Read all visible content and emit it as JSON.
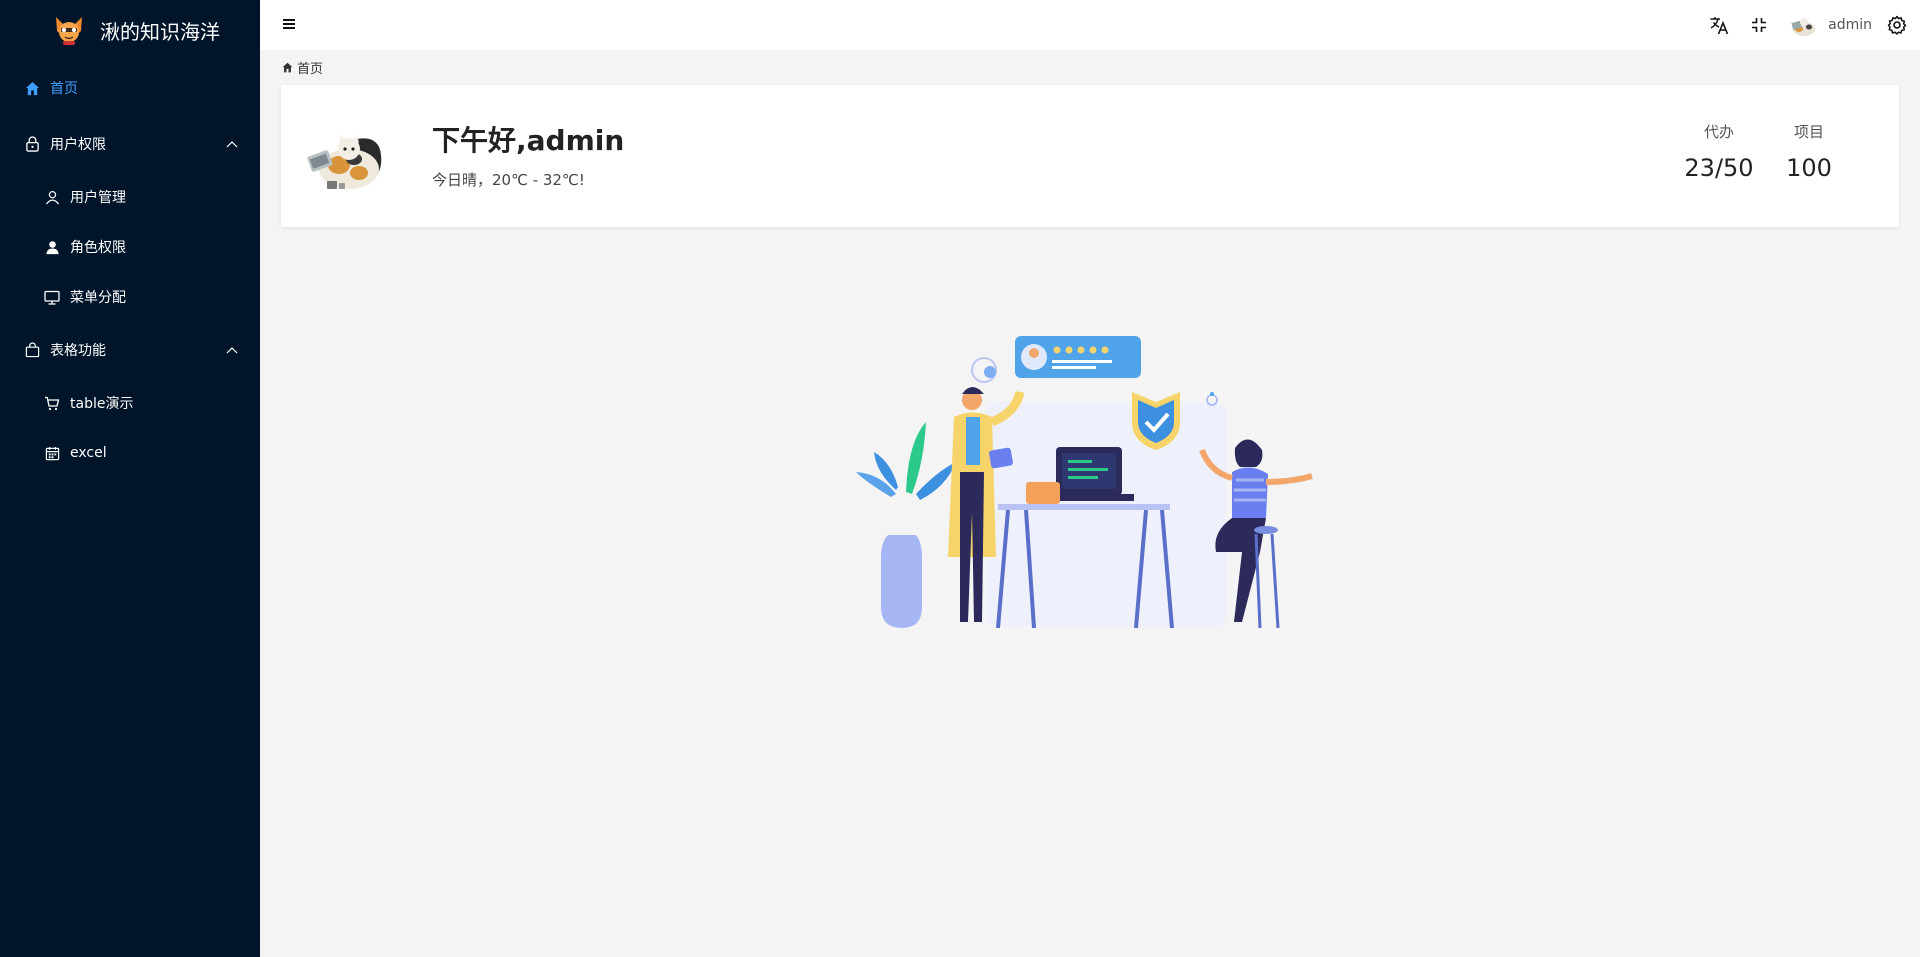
{
  "app": {
    "title": "湫的知识海洋"
  },
  "sidebar": {
    "items": [
      {
        "label": "首页",
        "icon": "home-icon",
        "active": true
      },
      {
        "label": "用户权限",
        "icon": "lock-icon",
        "expanded": true,
        "children": [
          {
            "label": "用户管理",
            "icon": "user-outline-icon"
          },
          {
            "label": "角色权限",
            "icon": "user-filled-icon"
          },
          {
            "label": "菜单分配",
            "icon": "monitor-icon"
          }
        ]
      },
      {
        "label": "表格功能",
        "icon": "shopping-bag-icon",
        "expanded": true,
        "children": [
          {
            "label": "table演示",
            "icon": "cart-icon"
          },
          {
            "label": "excel",
            "icon": "calendar-icon"
          }
        ]
      }
    ]
  },
  "header": {
    "username": "admin",
    "icons": [
      "menu-icon",
      "translate-icon",
      "fullscreen-exit-icon",
      "avatar",
      "gear-icon"
    ]
  },
  "breadcrumb": {
    "home": "首页"
  },
  "welcome": {
    "greeting": "下午好,admin",
    "weather": "今日晴，20℃ - 32℃!",
    "stats": [
      {
        "label": "代办",
        "value": "23/50"
      },
      {
        "label": "项目",
        "value": "100"
      }
    ]
  },
  "colors": {
    "sidebar_bg": "#001529",
    "active": "#409eff",
    "page_bg": "#f4f4f5"
  }
}
